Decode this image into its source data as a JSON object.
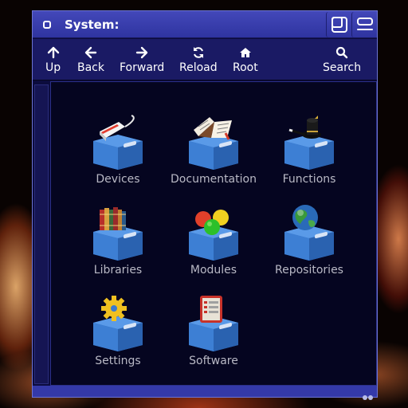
{
  "window": {
    "title": "System:"
  },
  "toolbar": {
    "up": "Up",
    "back": "Back",
    "forward": "Forward",
    "reload": "Reload",
    "root": "Root",
    "search": "Search"
  },
  "items": [
    {
      "label": "Devices",
      "icon": "devices-drawer-icon"
    },
    {
      "label": "Documentation",
      "icon": "documentation-drawer-icon"
    },
    {
      "label": "Functions",
      "icon": "functions-drawer-icon"
    },
    {
      "label": "Libraries",
      "icon": "libraries-drawer-icon"
    },
    {
      "label": "Modules",
      "icon": "modules-drawer-icon"
    },
    {
      "label": "Repositories",
      "icon": "repositories-drawer-icon"
    },
    {
      "label": "Settings",
      "icon": "settings-drawer-icon"
    },
    {
      "label": "Software",
      "icon": "software-drawer-icon"
    }
  ],
  "colors": {
    "titlebar": "#3a3fae",
    "toolbar": "#1a1a64",
    "content_bg": "#050520",
    "drawer_blue": "#3d7fd4",
    "label_text": "#b9b9c5"
  }
}
